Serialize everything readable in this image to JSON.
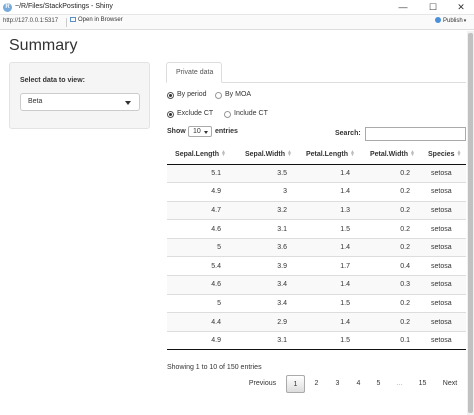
{
  "window": {
    "icon_letter": "R",
    "title": "~/R/Files/StackPostings - Shiny",
    "minimize_glyph": "—",
    "maximize_glyph": "☐",
    "close_glyph": "✕"
  },
  "toolbar": {
    "url": "http://127.0.0.1:5317",
    "open_in_browser": "Open in Browser",
    "publish": "Publish",
    "publish_caret": "▾"
  },
  "page": {
    "title": "Summary"
  },
  "sidebar": {
    "select_label": "Select data to view:",
    "select_value": "Beta"
  },
  "tabs": [
    {
      "label": "Private data",
      "active": true
    }
  ],
  "radio_groups": [
    {
      "options": [
        {
          "label": "By period",
          "checked": true
        },
        {
          "label": "By MOA",
          "checked": false
        }
      ]
    },
    {
      "options": [
        {
          "label": "Exclude CT",
          "checked": true
        },
        {
          "label": "Include CT",
          "checked": false
        }
      ]
    }
  ],
  "table_controls": {
    "show_label": "Show",
    "page_length": "10",
    "entries_label": "entries",
    "search_label": "Search:",
    "search_value": ""
  },
  "table": {
    "columns": [
      "Sepal.Length",
      "Sepal.Width",
      "Petal.Length",
      "Petal.Width",
      "Species"
    ],
    "rows": [
      [
        "5.1",
        "3.5",
        "1.4",
        "0.2",
        "setosa"
      ],
      [
        "4.9",
        "3",
        "1.4",
        "0.2",
        "setosa"
      ],
      [
        "4.7",
        "3.2",
        "1.3",
        "0.2",
        "setosa"
      ],
      [
        "4.6",
        "3.1",
        "1.5",
        "0.2",
        "setosa"
      ],
      [
        "5",
        "3.6",
        "1.4",
        "0.2",
        "setosa"
      ],
      [
        "5.4",
        "3.9",
        "1.7",
        "0.4",
        "setosa"
      ],
      [
        "4.6",
        "3.4",
        "1.4",
        "0.3",
        "setosa"
      ],
      [
        "5",
        "3.4",
        "1.5",
        "0.2",
        "setosa"
      ],
      [
        "4.4",
        "2.9",
        "1.4",
        "0.2",
        "setosa"
      ],
      [
        "4.9",
        "3.1",
        "1.5",
        "0.1",
        "setosa"
      ]
    ]
  },
  "table_info": "Showing 1 to 10 of 150 entries",
  "pagination": {
    "previous": "Previous",
    "pages": [
      "1",
      "2",
      "3",
      "4",
      "5",
      "…",
      "15"
    ],
    "current": "1",
    "next": "Next"
  }
}
